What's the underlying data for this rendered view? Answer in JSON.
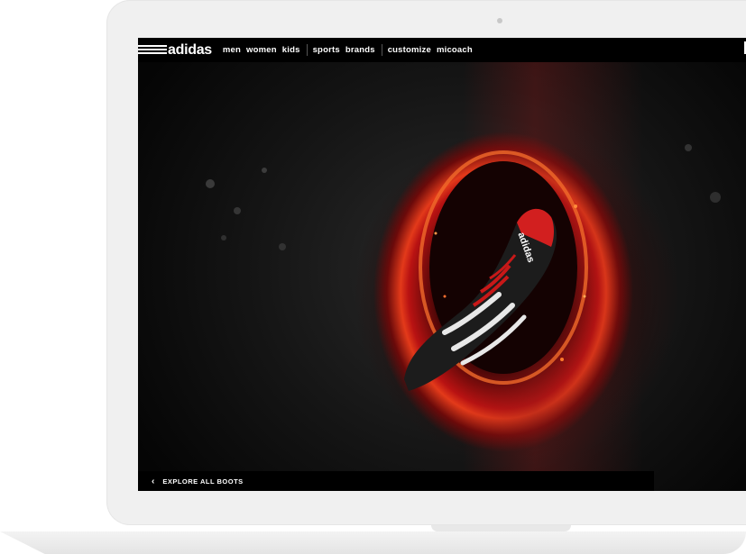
{
  "brand": {
    "logo_text": "adidas"
  },
  "nav": {
    "group1": [
      "men",
      "women",
      "kids"
    ],
    "group2": [
      "sports",
      "brands"
    ],
    "group3": [
      "customize",
      "micoach"
    ]
  },
  "hero": {
    "boot_brand_text": "adidas"
  },
  "footer": {
    "explore_label": "EXPLORE ALL BOOTS"
  },
  "icons": {
    "back": "chevron-left-icon"
  },
  "colors": {
    "accent_red": "#e33a1a",
    "nav_bg": "#000000",
    "frame": "#f0f0f0"
  }
}
